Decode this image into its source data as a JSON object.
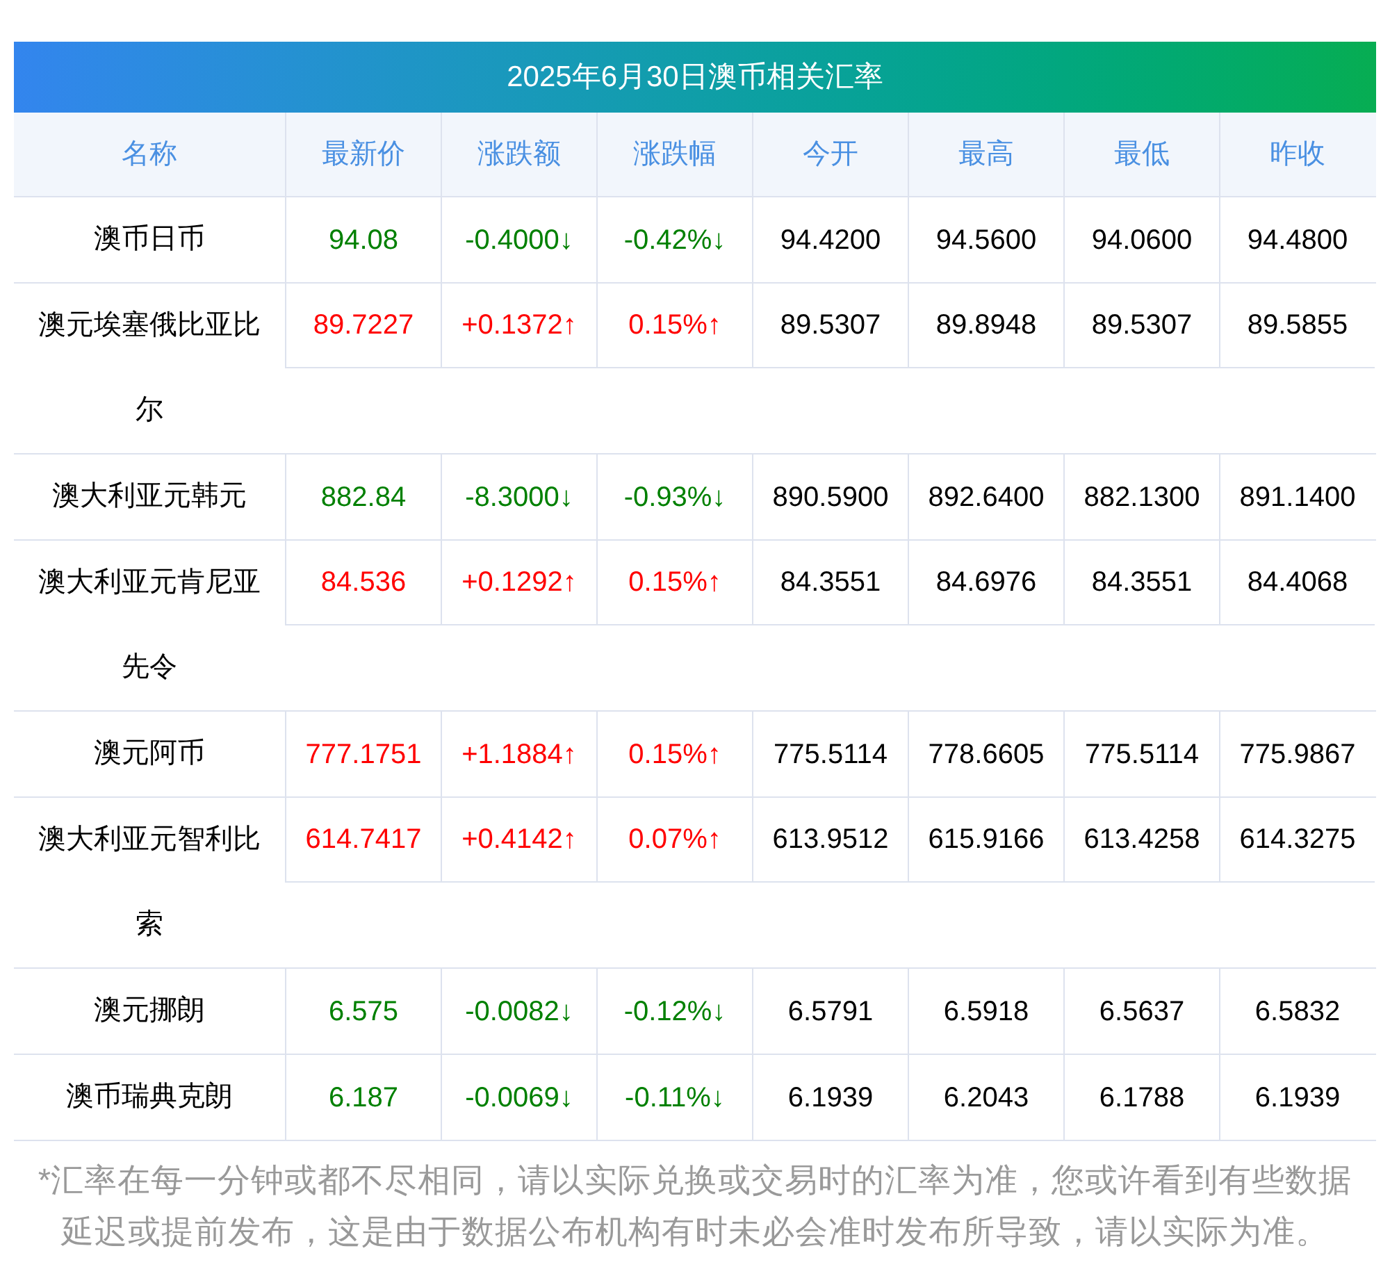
{
  "title": "2025年6月30日澳币相关汇率",
  "columns": [
    "名称",
    "最新价",
    "涨跌额",
    "涨跌幅",
    "今开",
    "最高",
    "最低",
    "昨收"
  ],
  "rows": [
    {
      "name": "澳币日币",
      "kind": "down",
      "latest": "94.08",
      "change": "-0.4000↓",
      "pct": "-0.42%↓",
      "open": "94.4200",
      "high": "94.5600",
      "low": "94.0600",
      "prev": "94.4800"
    },
    {
      "name": "澳元埃塞俄比亚比尔",
      "kind": "up",
      "latest": "89.7227",
      "change": "+0.1372↑",
      "pct": "0.15%↑",
      "open": "89.5307",
      "high": "89.8948",
      "low": "89.5307",
      "prev": "89.5855"
    },
    {
      "name": "澳大利亚元韩元",
      "kind": "down",
      "latest": "882.84",
      "change": "-8.3000↓",
      "pct": "-0.93%↓",
      "open": "890.5900",
      "high": "892.6400",
      "low": "882.1300",
      "prev": "891.1400"
    },
    {
      "name": "澳大利亚元肯尼亚先令",
      "kind": "up",
      "latest": "84.536",
      "change": "+0.1292↑",
      "pct": "0.15%↑",
      "open": "84.3551",
      "high": "84.6976",
      "low": "84.3551",
      "prev": "84.4068"
    },
    {
      "name": "澳元阿币",
      "kind": "up",
      "latest": "777.1751",
      "change": "+1.1884↑",
      "pct": "0.15%↑",
      "open": "775.5114",
      "high": "778.6605",
      "low": "775.5114",
      "prev": "775.9867"
    },
    {
      "name": "澳大利亚元智利比索",
      "kind": "up",
      "latest": "614.7417",
      "change": "+0.4142↑",
      "pct": "0.07%↑",
      "open": "613.9512",
      "high": "615.9166",
      "low": "613.4258",
      "prev": "614.3275"
    },
    {
      "name": "澳元挪朗",
      "kind": "down",
      "latest": "6.575",
      "change": "-0.0082↓",
      "pct": "-0.12%↓",
      "open": "6.5791",
      "high": "6.5918",
      "low": "6.5637",
      "prev": "6.5832"
    },
    {
      "name": "澳币瑞典克朗",
      "kind": "down",
      "latest": "6.187",
      "change": "-0.0069↓",
      "pct": "-0.11%↓",
      "open": "6.1939",
      "high": "6.2043",
      "low": "6.1788",
      "prev": "6.1939"
    }
  ],
  "note": "*汇率在每一分钟或都不尽相同，请以实际兑换或交易时的汇率为准，您或许看到有些数据延迟或提前发布，这是由于数据公布机构有时未必会准时发布所导致，请以实际为准。"
}
